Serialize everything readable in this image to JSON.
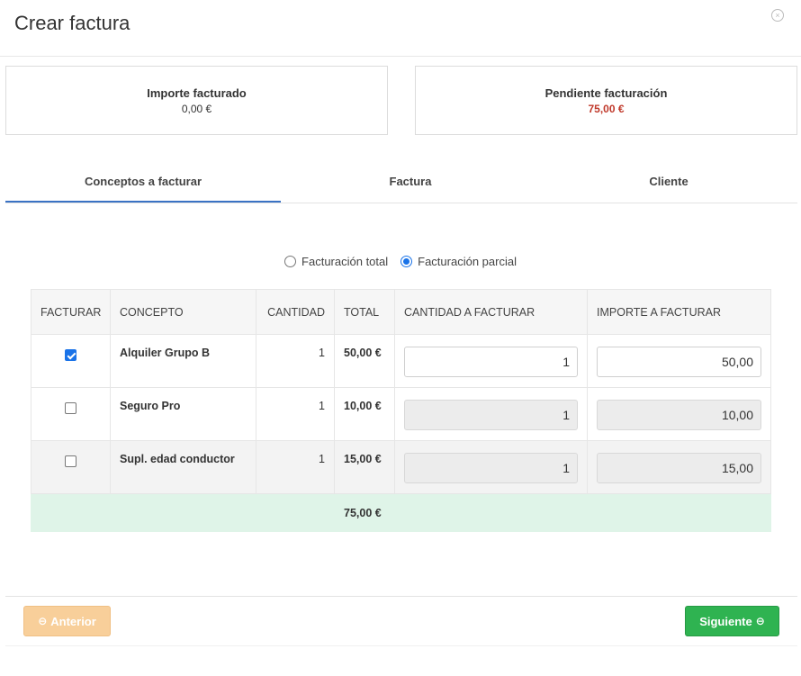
{
  "modal": {
    "title": "Crear factura",
    "close_icon": "×"
  },
  "summary": {
    "billed_label": "Importe facturado",
    "billed_value": "0,00 €",
    "pending_label": "Pendiente facturación",
    "pending_value": "75,00 €",
    "pending_color": "#c0392b"
  },
  "tabs": [
    {
      "label": "Conceptos a facturar",
      "active": true
    },
    {
      "label": "Factura",
      "active": false
    },
    {
      "label": "Cliente",
      "active": false
    }
  ],
  "billing_mode": {
    "options": [
      "Facturación total",
      "Facturación parcial"
    ],
    "selected": "Facturación parcial"
  },
  "table": {
    "headers": [
      "FACTURAR",
      "CONCEPTO",
      "CANTIDAD",
      "TOTAL",
      "CANTIDAD A FACTURAR",
      "IMPORTE A FACTURAR"
    ],
    "rows": [
      {
        "checked": true,
        "concept": "Alquiler Grupo B",
        "qty": "1",
        "total": "50,00 €",
        "qty_to_bill": "1",
        "amount_to_bill": "50,00",
        "editable": true
      },
      {
        "checked": false,
        "concept": "Seguro Pro",
        "qty": "1",
        "total": "10,00 €",
        "qty_to_bill": "1",
        "amount_to_bill": "10,00",
        "editable": false
      },
      {
        "checked": false,
        "concept": "Supl. edad conductor",
        "qty": "1",
        "total": "15,00 €",
        "qty_to_bill": "1",
        "amount_to_bill": "15,00",
        "editable": false
      }
    ],
    "sum_total": "75,00 €"
  },
  "footer": {
    "prev_label": "Anterior",
    "next_label": "Siguiente",
    "prev_color": "#f8cf9a",
    "next_color": "#2fb351"
  }
}
